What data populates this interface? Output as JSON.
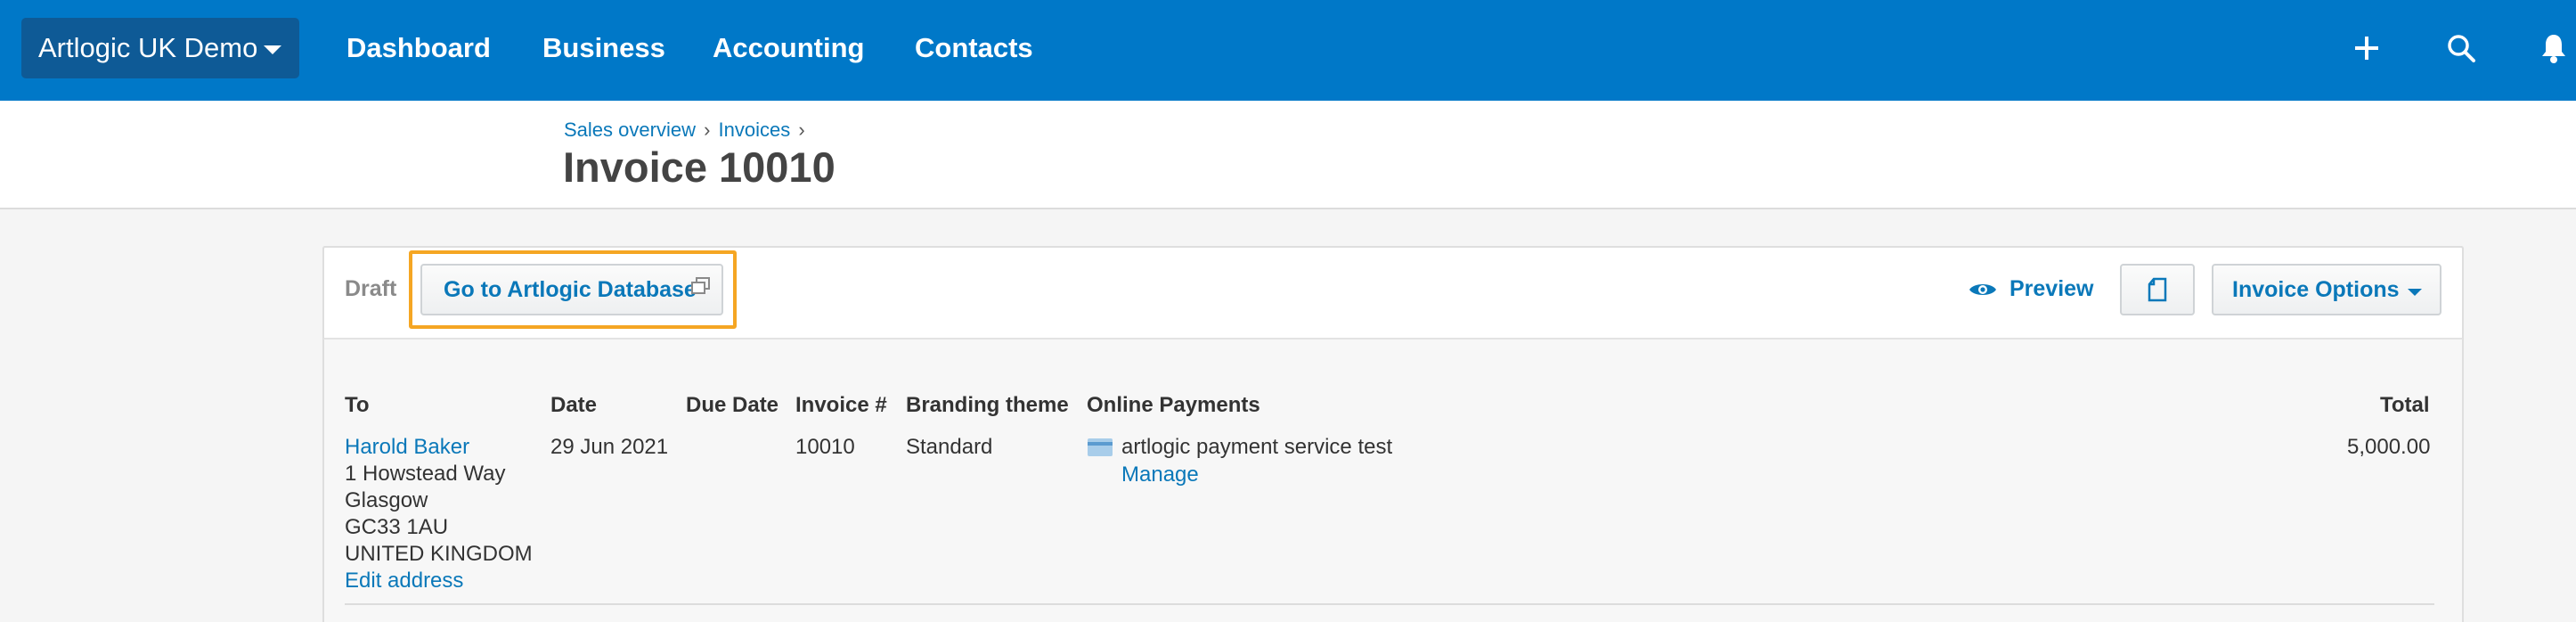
{
  "topnav": {
    "org_name": "Artlogic UK Demo",
    "items": [
      "Dashboard",
      "Business",
      "Accounting",
      "Contacts"
    ],
    "icons": [
      "plus-icon",
      "search-icon",
      "bell-icon"
    ]
  },
  "breadcrumb": {
    "items": [
      "Sales overview",
      "Invoices"
    ],
    "separator": "›"
  },
  "page": {
    "title": "Invoice 10010"
  },
  "toolbar": {
    "status": "Draft",
    "goto_label": "Go to Artlogic Database",
    "preview_label": "Preview",
    "options_label": "Invoice Options"
  },
  "invoice": {
    "headers": {
      "to": "To",
      "date": "Date",
      "due_date": "Due Date",
      "invoice_no": "Invoice #",
      "branding": "Branding theme",
      "online_payments": "Online Payments",
      "total": "Total"
    },
    "to": {
      "name": "Harold Baker",
      "address": [
        "1 Howstead Way",
        "Glasgow",
        "GC33 1AU",
        "UNITED KINGDOM"
      ],
      "edit_label": "Edit address"
    },
    "date": "29 Jun 2021",
    "due_date": "",
    "invoice_no": "10010",
    "branding": "Standard",
    "payment_service": "artlogic payment service test",
    "manage_label": "Manage",
    "total": "5,000.00"
  },
  "colors": {
    "nav_bg": "#0078c8",
    "org_switch_bg": "#0e5a96",
    "link": "#0a78b9",
    "highlight": "#f5a623"
  }
}
